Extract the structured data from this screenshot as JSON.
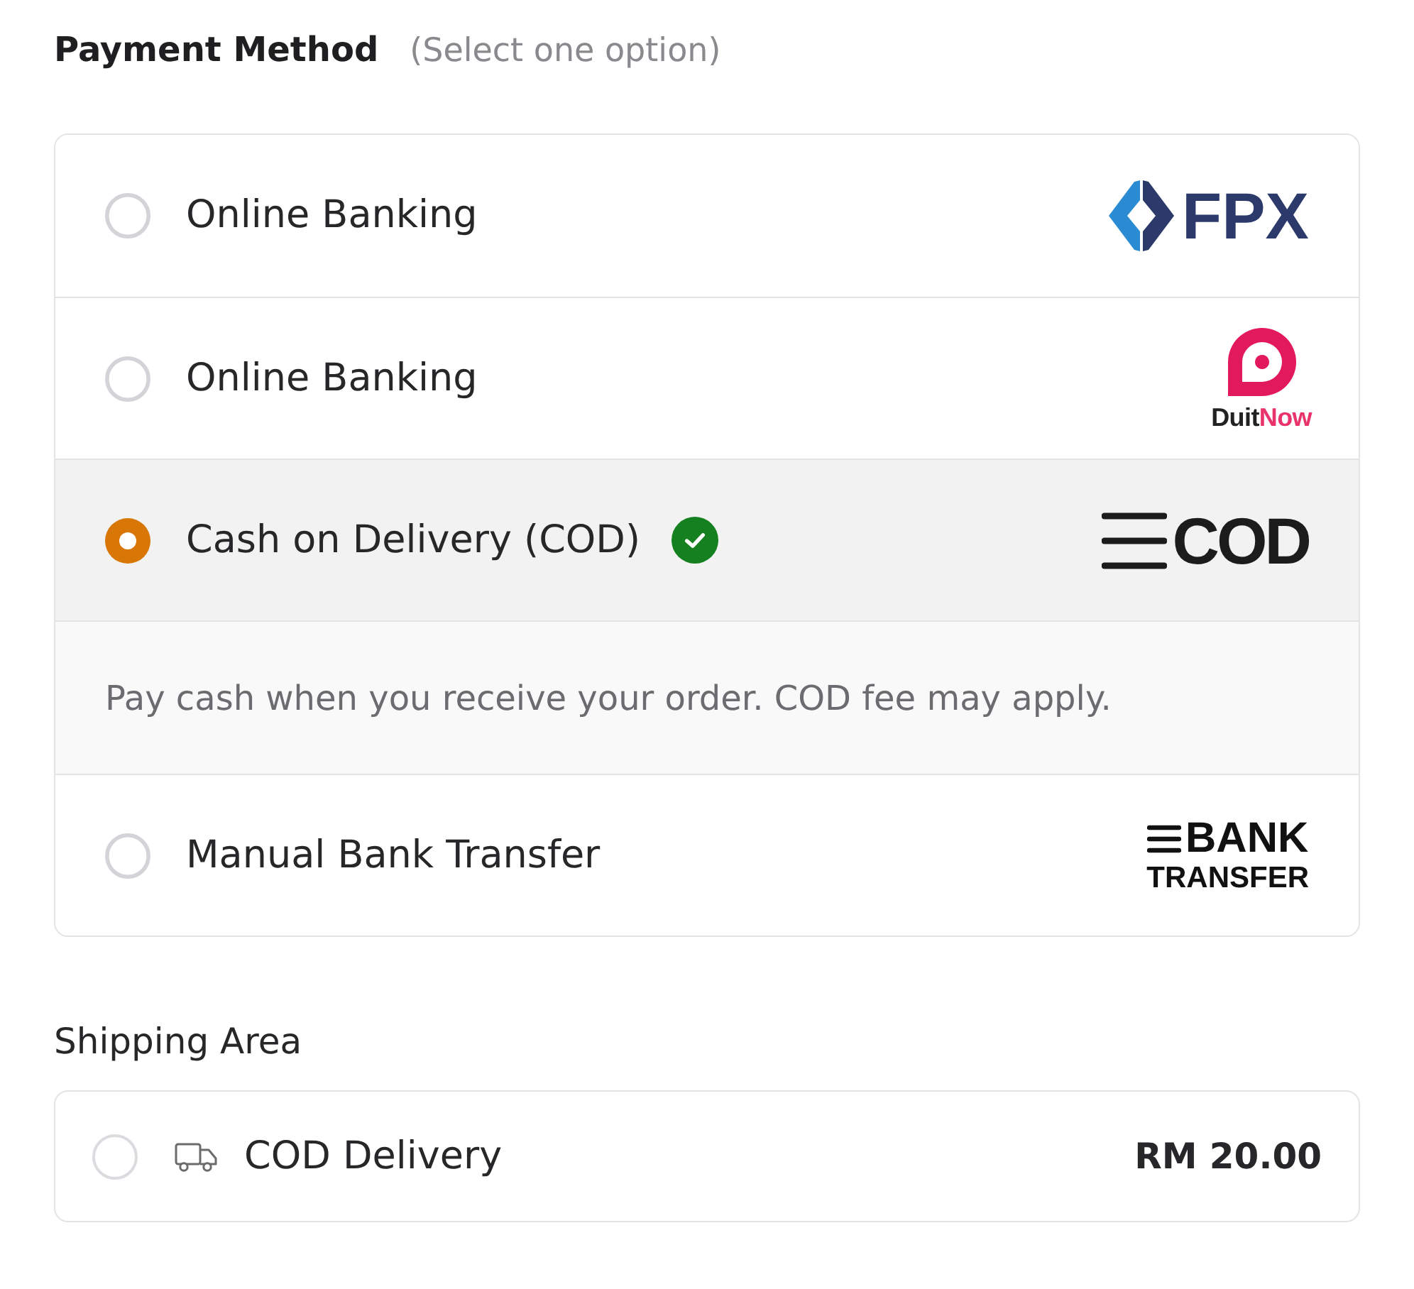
{
  "payment_method": {
    "title": "Payment Method",
    "hint": "(Select one option)",
    "options": [
      {
        "label": "Online Banking",
        "selected": false,
        "logo": {
          "kind": "fpx",
          "parts": [
            "FPX"
          ]
        }
      },
      {
        "label": "Online Banking",
        "selected": false,
        "logo": {
          "kind": "duitnow",
          "parts": [
            "Duit",
            "Now"
          ]
        }
      },
      {
        "label": "Cash on Delivery (COD)",
        "selected": true,
        "description": "Pay cash when you receive your order. COD fee may apply.",
        "logo": {
          "kind": "cod",
          "parts": [
            "COD"
          ]
        }
      },
      {
        "label": "Manual Bank Transfer",
        "selected": false,
        "logo": {
          "kind": "bank_transfer",
          "parts": [
            "BANK",
            "TRANSFER"
          ]
        }
      }
    ]
  },
  "shipping_area": {
    "title": "Shipping Area",
    "options": [
      {
        "label": "COD Delivery",
        "price": "RM 20.00",
        "selected": false
      }
    ]
  }
}
